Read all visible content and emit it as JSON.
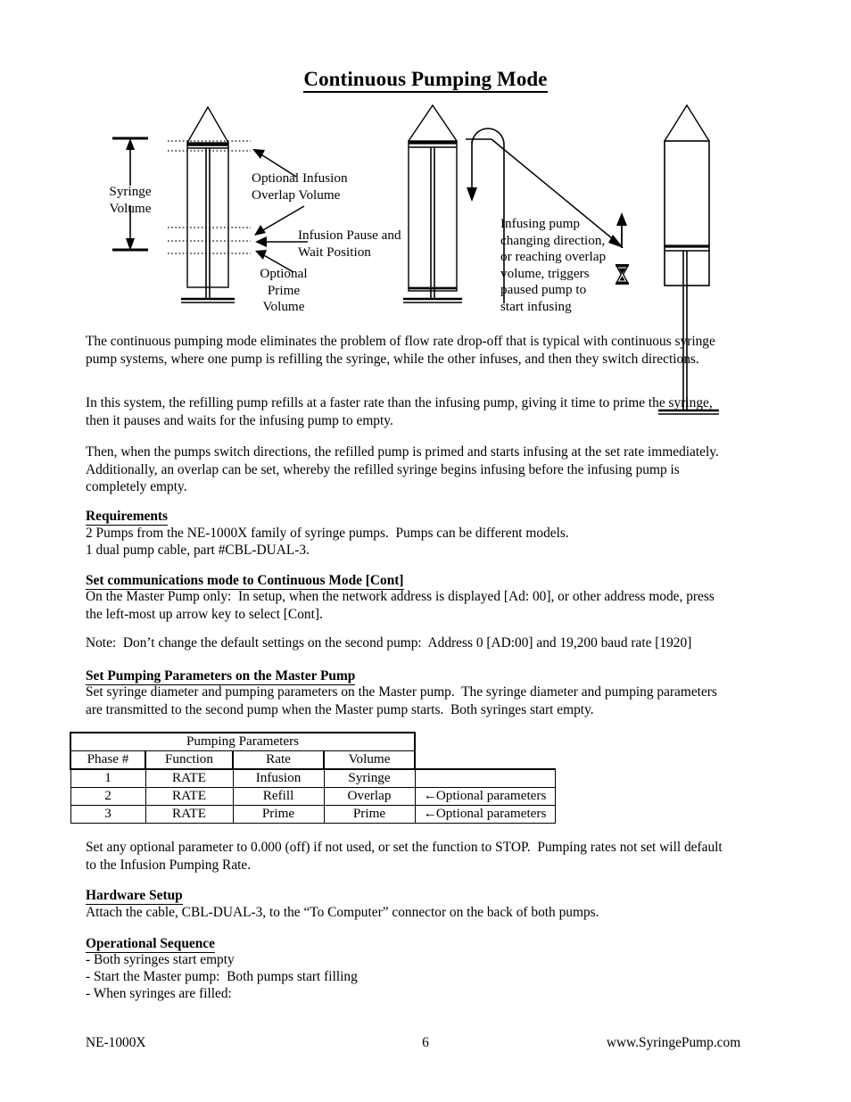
{
  "document": {
    "title": "Continuous Pumping Mode"
  },
  "diagram": {
    "syringe_volume_label": "Syringe\nVolume",
    "callout_overlap": "Optional Infusion\nOverlap Volume",
    "callout_pause": "Infusion Pause and\nWait Position",
    "callout_prime": "Optional\nPrime\nVolume",
    "callout_trigger": "Infusing pump\nchanging direction,\nor reaching overlap\nvolume, triggers\npaused pump to\nstart infusing",
    "hourglass_icon": "hourglass-icon"
  },
  "body": {
    "paragraph1": "The continuous pumping mode eliminates the problem of flow rate drop-off that is typical with continuous syringe pump systems, where one pump is refilling the syringe, while the other infuses, and then they switch directions.",
    "paragraph2": "In this system, the refilling pump refills at a faster rate than the infusing pump, giving it time to prime the syringe, then it pauses and waits for the infusing pump to empty.",
    "paragraph3": "Then, when the pumps switch directions, the refilled pump is primed and starts infusing at the set rate immediately.  Additionally, an overlap can be set, whereby the refilled syringe begins infusing before the infusing pump is completely empty."
  },
  "sections": {
    "requirements": {
      "heading": "Requirements",
      "line1": "2 Pumps from the NE-1000X family of syringe pumps.  Pumps can be different models.",
      "line2": "1 dual pump cable, part #CBL-DUAL-3."
    },
    "comms_mode": {
      "heading": "Set communications mode to Continuous Mode [Cont]",
      "body": "On the Master Pump only:  In setup, when the network address is displayed [Ad: 00], or other address mode, press the left-most up arrow key to select [Cont].",
      "note": "Note:  Don’t change the default settings on the second pump:  Address 0 [AD:00] and 19,200 baud rate [1920]"
    },
    "pumping_params": {
      "heading": "Set Pumping Parameters on the Master Pump",
      "body": "Set syringe diameter and pumping parameters on the Master pump.  The syringe diameter and pumping parameters are transmitted to the second pump when the Master pump starts.  Both syringes start empty.",
      "after_table": "Set any optional parameter to 0.000 (off) if not used, or set the function to STOP.  Pumping rates not set will default to the Infusion Pumping Rate."
    },
    "hardware_setup": {
      "heading": "Hardware Setup",
      "body": "Attach the cable, CBL-DUAL-3, to the “To Computer” connector on the back of both pumps."
    },
    "operational_sequence": {
      "heading": "Operational Sequence",
      "items": [
        "- Both syringes start empty",
        "- Start the Master pump:  Both pumps start filling",
        "- When syringes are filled:"
      ]
    }
  },
  "table": {
    "span_header": "Pumping Parameters",
    "columns": [
      "Phase #",
      "Function",
      "Rate",
      "Volume"
    ],
    "rows": [
      {
        "phase": "1",
        "function": "RATE",
        "rate": "Infusion",
        "volume": "Syringe",
        "note": ""
      },
      {
        "phase": "2",
        "function": "RATE",
        "rate": "Refill",
        "volume": "Overlap",
        "note": "Optional parameters"
      },
      {
        "phase": "3",
        "function": "RATE",
        "rate": "Prime",
        "volume": "Prime",
        "note": "Optional parameters"
      }
    ],
    "note_arrow": "←"
  },
  "footer": {
    "left": "NE-1000X",
    "page_number": "6",
    "right": "www.SyringePump.com"
  },
  "colors": {
    "ink": "#000000",
    "paper": "#ffffff"
  }
}
